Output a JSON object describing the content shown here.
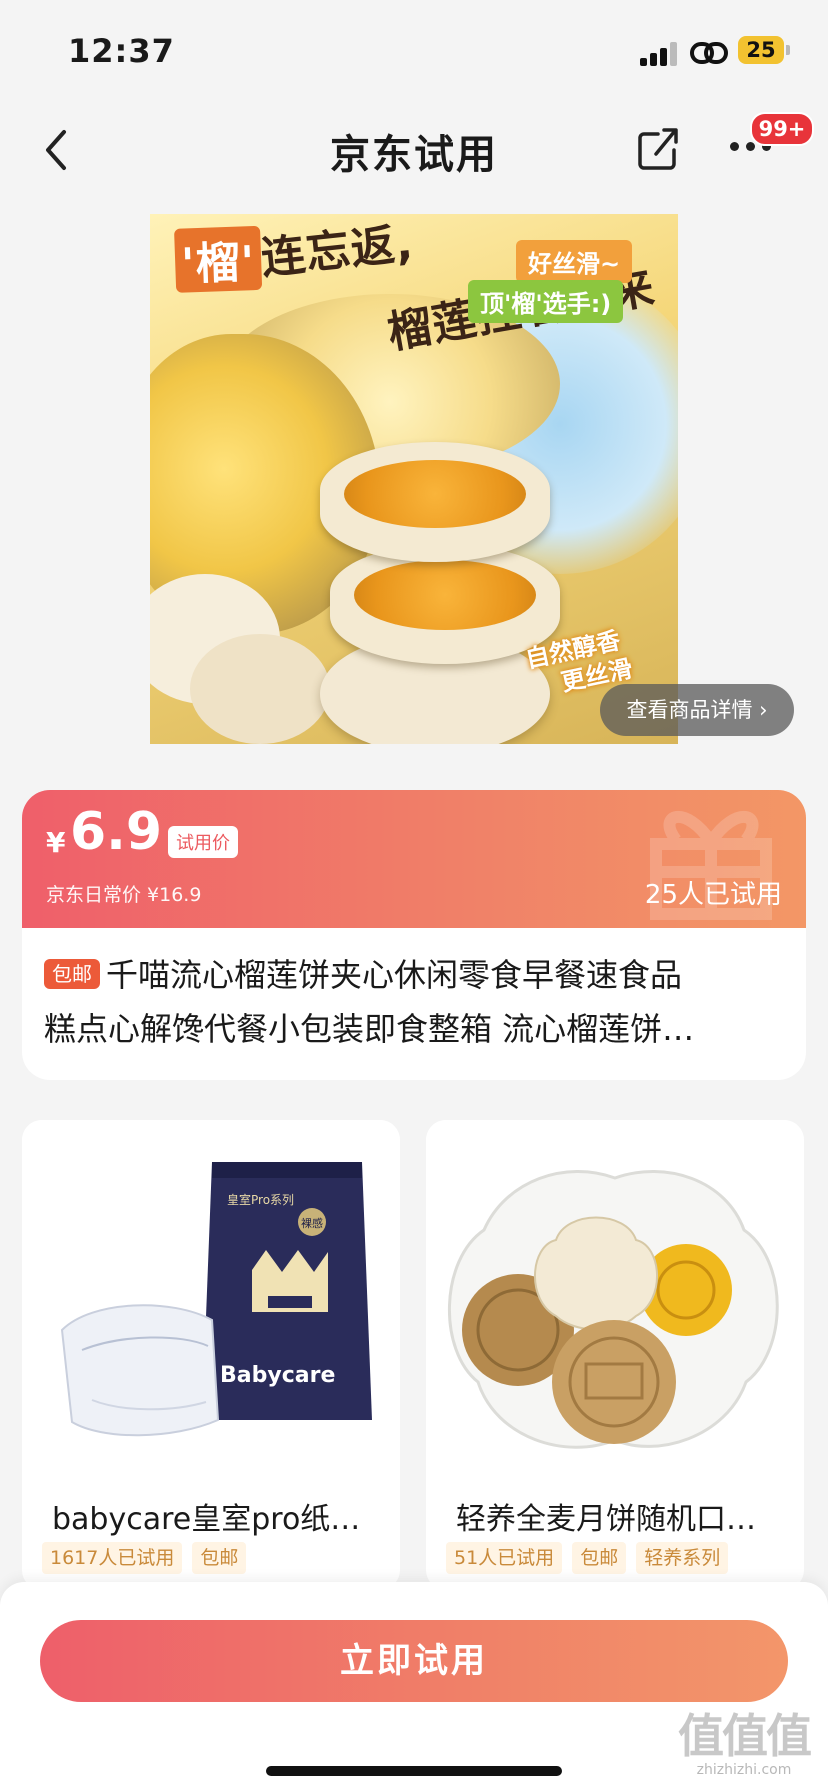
{
  "status_bar": {
    "time": "12:37",
    "battery": "25"
  },
  "nav": {
    "title": "京东试用",
    "badge": "99+"
  },
  "hero": {
    "headline1_box": "'榴'",
    "headline1_rest": "连忘返,",
    "headline2": "榴莲控看过来",
    "tag1": "好丝滑~",
    "tag2": "顶'榴'选手:)",
    "note_line1": "自然醇香",
    "note_line2": "更丝滑",
    "detail_link": "查看商品详情 ›"
  },
  "product": {
    "currency": "¥",
    "price": "6.9",
    "price_label": "试用价",
    "regular_price": "京东日常价 ¥16.9",
    "tried_count": "25人已试用",
    "shipping_tag": "包邮",
    "title_line1": "千喵流心榴莲饼夹心休闲零食早餐速食品",
    "title_line2": "糕点心解馋代餐小包装即食整箱 流心榴莲饼…"
  },
  "recommendations": [
    {
      "title": "babycare皇室pro纸…",
      "tags": [
        "1617人已试用",
        "包邮"
      ],
      "package_series": "皇室Pro系列",
      "package_brand": "Babycare",
      "package_badge": "裸感"
    },
    {
      "title": "轻养全麦月饼随机口…",
      "tags": [
        "51人已试用",
        "包邮",
        "轻养系列"
      ]
    }
  ],
  "cta": {
    "label": "立即试用"
  },
  "watermark": {
    "big": "值值值",
    "small": "zhizhizhi.com"
  },
  "colors": {
    "accent": "#ef5f6a",
    "accent_end": "#f3966a",
    "tag_bg": "#fff4e4",
    "tag_text": "#c98a3a",
    "shipping": "#ec5a39"
  }
}
